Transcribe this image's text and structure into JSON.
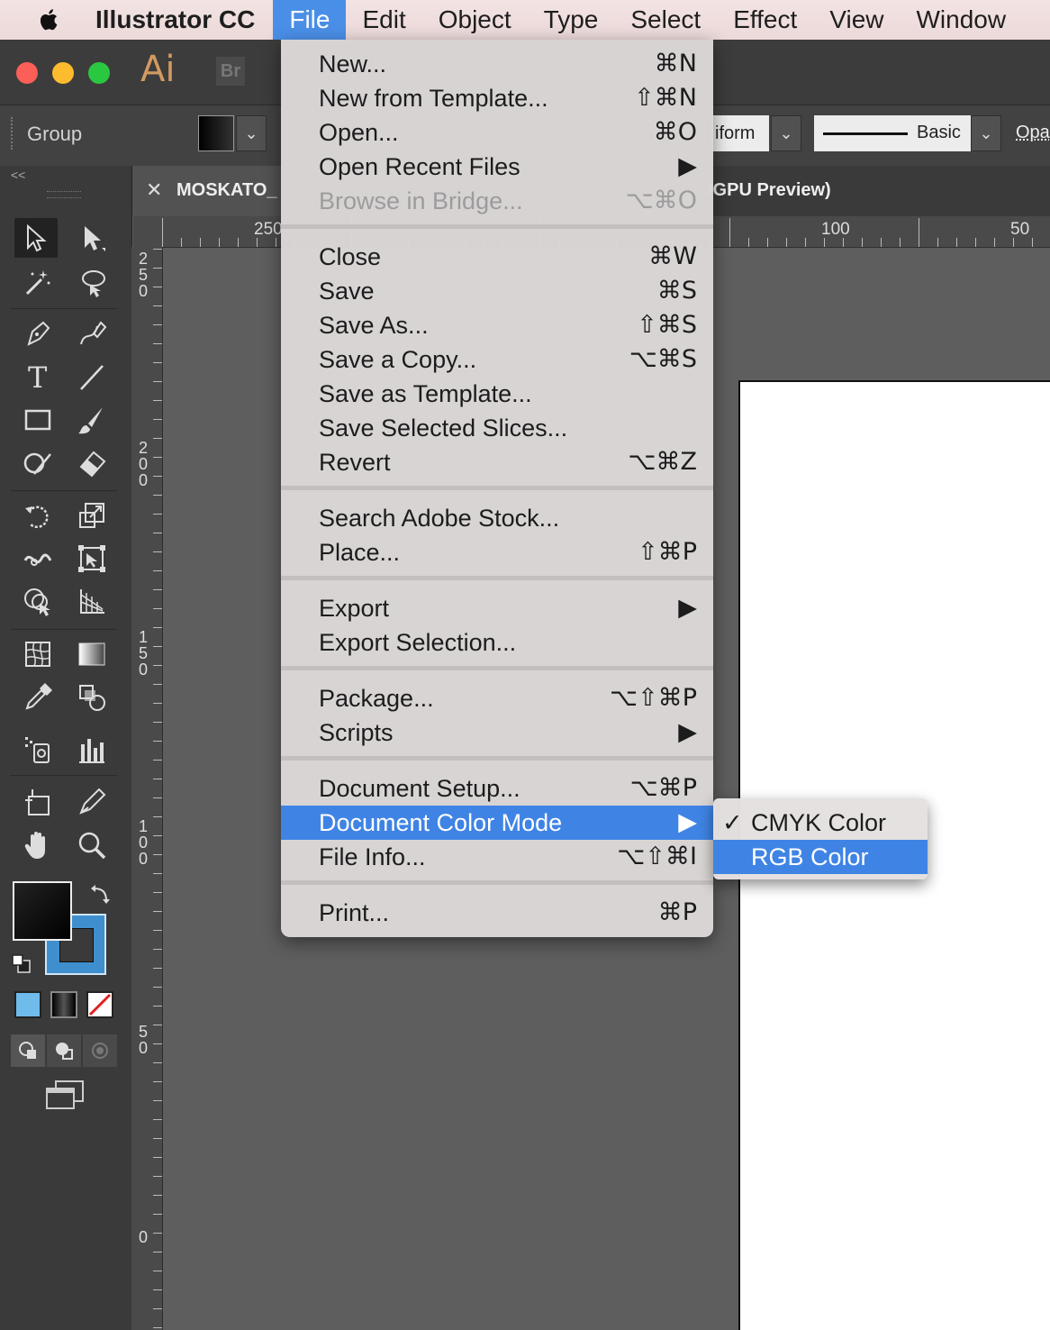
{
  "menubar": {
    "app_name": "Illustrator CC",
    "items": [
      "File",
      "Edit",
      "Object",
      "Type",
      "Select",
      "Effect",
      "View",
      "Window"
    ]
  },
  "app": {
    "ai_logo": "Ai",
    "bridge_logo": "Br"
  },
  "control_bar": {
    "selection_label": "Group",
    "dropdown_chevron": "⌄",
    "uniform_partial": "iform",
    "stroke_profile": "Basic",
    "opacity_partial": "Opa"
  },
  "document_tab": {
    "close_glyph": "✕",
    "name_partial": "MOSKATO_",
    "view_suffix_partial": "/GPU Preview)"
  },
  "rulers": {
    "horizontal": [
      "250",
      "100",
      "50"
    ],
    "vertical": [
      [
        "2",
        "5",
        "0"
      ],
      [
        "2",
        "0",
        "0"
      ],
      [
        "1",
        "5",
        "0"
      ],
      [
        "1",
        "0",
        "0"
      ],
      [
        "5",
        "0"
      ],
      [
        "0"
      ]
    ]
  },
  "file_menu": {
    "groups": [
      [
        {
          "label": "New...",
          "shortcut": "⌘N"
        },
        {
          "label": "New from Template...",
          "shortcut": "⇧⌘N"
        },
        {
          "label": "Open...",
          "shortcut": "⌘O"
        },
        {
          "label": "Open Recent Files",
          "shortcut": "▶"
        },
        {
          "label": "Browse in Bridge...",
          "shortcut": "⌥⌘O",
          "disabled": true
        }
      ],
      [
        {
          "label": "Close",
          "shortcut": "⌘W"
        },
        {
          "label": "Save",
          "shortcut": "⌘S"
        },
        {
          "label": "Save As...",
          "shortcut": "⇧⌘S"
        },
        {
          "label": "Save a Copy...",
          "shortcut": "⌥⌘S"
        },
        {
          "label": "Save as Template...",
          "shortcut": ""
        },
        {
          "label": "Save Selected Slices...",
          "shortcut": ""
        },
        {
          "label": "Revert",
          "shortcut": "⌥⌘Z"
        }
      ],
      [
        {
          "label": "Search Adobe Stock...",
          "shortcut": ""
        },
        {
          "label": "Place...",
          "shortcut": "⇧⌘P"
        }
      ],
      [
        {
          "label": "Export",
          "shortcut": "▶"
        },
        {
          "label": "Export Selection...",
          "shortcut": ""
        }
      ],
      [
        {
          "label": "Package...",
          "shortcut": "⌥⇧⌘P"
        },
        {
          "label": "Scripts",
          "shortcut": "▶"
        }
      ],
      [
        {
          "label": "Document Setup...",
          "shortcut": "⌥⌘P"
        },
        {
          "label": "Document Color Mode",
          "shortcut": "▶",
          "highlighted": true
        },
        {
          "label": "File Info...",
          "shortcut": "⌥⇧⌘I"
        }
      ],
      [
        {
          "label": "Print...",
          "shortcut": "⌘P"
        }
      ]
    ]
  },
  "color_mode_submenu": {
    "items": [
      {
        "label": "CMYK Color",
        "checked": true,
        "check_glyph": "✓"
      },
      {
        "label": "RGB Color",
        "highlighted": true
      }
    ]
  },
  "tools": [
    "selection-tool",
    "direct-selection-tool",
    "magic-wand-tool",
    "lasso-tool",
    "pen-tool",
    "curvature-tool",
    "type-tool",
    "line-segment-tool",
    "rectangle-tool",
    "paintbrush-tool",
    "shaper-tool",
    "eraser-tool",
    "rotate-tool",
    "scale-tool",
    "width-tool",
    "free-transform-tool",
    "shape-builder-tool",
    "perspective-grid-tool",
    "mesh-tool",
    "gradient-tool",
    "eyedropper-tool",
    "blend-tool",
    "symbol-sprayer-tool",
    "column-graph-tool",
    "artboard-tool",
    "slice-tool",
    "hand-tool",
    "zoom-tool"
  ],
  "colors": {
    "menu_highlight": "#3f84e5",
    "stroke_swatch": "#3f8fcf",
    "fill_swatch": "#000000",
    "traffic_close": "#fc5f57",
    "traffic_min": "#fdbc2e",
    "traffic_max": "#29c840"
  }
}
